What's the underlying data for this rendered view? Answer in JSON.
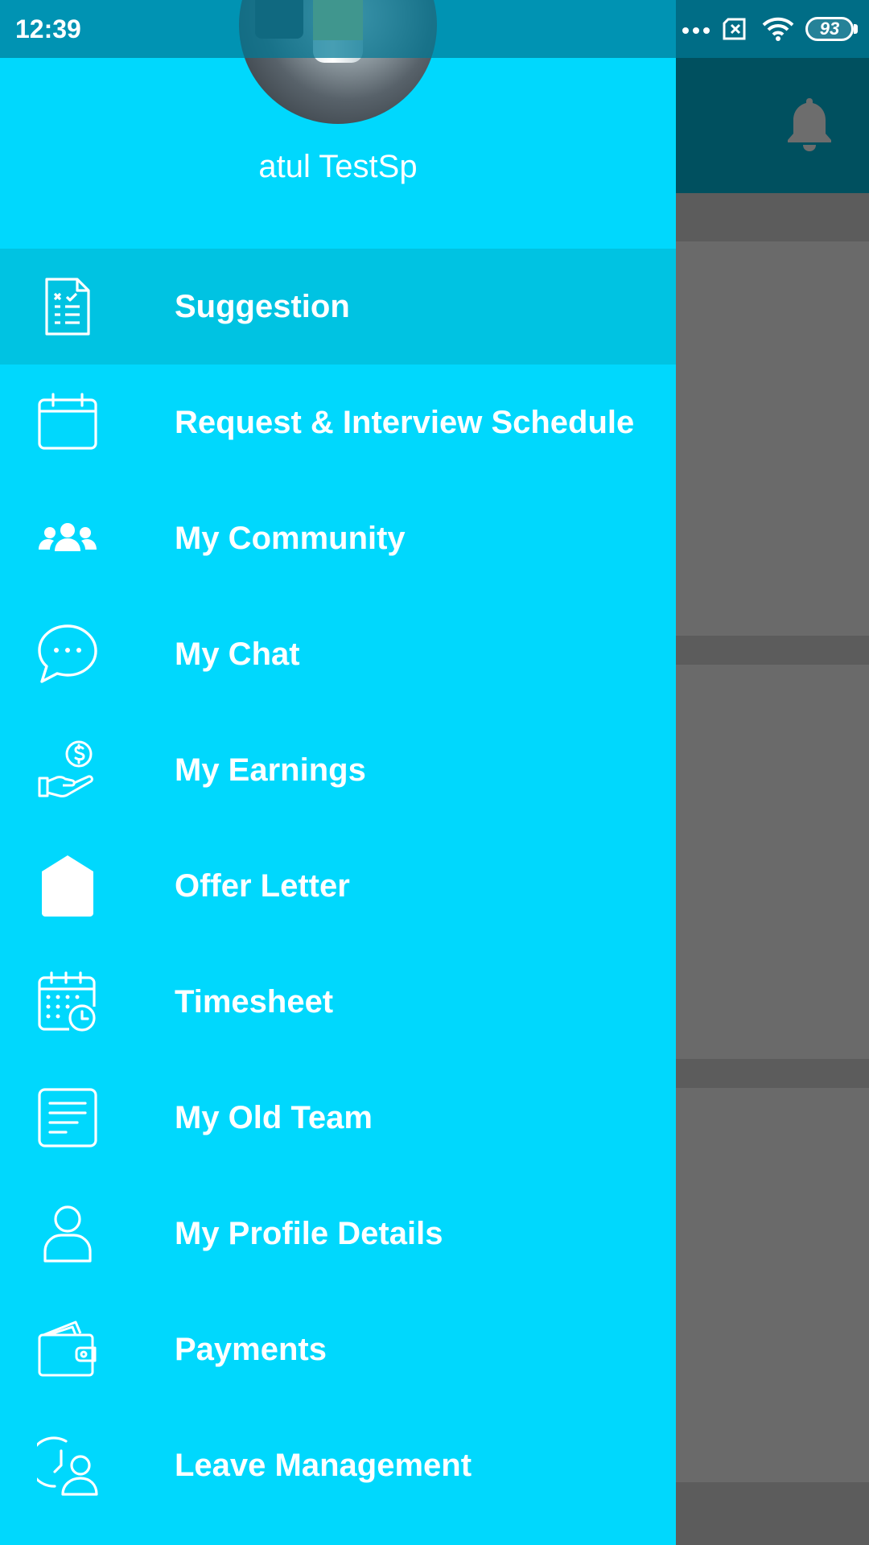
{
  "status_bar": {
    "time": "12:39",
    "battery": "93",
    "icons": [
      "more-dots-icon",
      "no-sim-icon",
      "wifi-icon",
      "battery-icon"
    ]
  },
  "background_app": {
    "notification_icon": "bell-icon"
  },
  "drawer": {
    "user_name": "atul TestSp",
    "menu": [
      {
        "label": "Suggestion",
        "icon": "checklist-icon",
        "active": true
      },
      {
        "label": "Request & Interview Schedule",
        "icon": "calendar-icon",
        "active": false
      },
      {
        "label": "My Community",
        "icon": "group-icon",
        "active": false
      },
      {
        "label": "My Chat",
        "icon": "chat-icon",
        "active": false
      },
      {
        "label": "My Earnings",
        "icon": "earnings-icon",
        "active": false
      },
      {
        "label": "Offer Letter",
        "icon": "envelope-icon",
        "active": false
      },
      {
        "label": "Timesheet",
        "icon": "timesheet-icon",
        "active": false
      },
      {
        "label": "My Old Team",
        "icon": "document-icon",
        "active": false
      },
      {
        "label": "My Profile Details",
        "icon": "profile-icon",
        "active": false
      },
      {
        "label": "Payments",
        "icon": "wallet-icon",
        "active": false
      },
      {
        "label": "Leave Management",
        "icon": "leave-icon",
        "active": false
      }
    ]
  },
  "colors": {
    "drawer": "#00d8fd",
    "active_item": "#00c3e2",
    "app_bar": "#00505f",
    "scrim": "#6a6a6a"
  }
}
